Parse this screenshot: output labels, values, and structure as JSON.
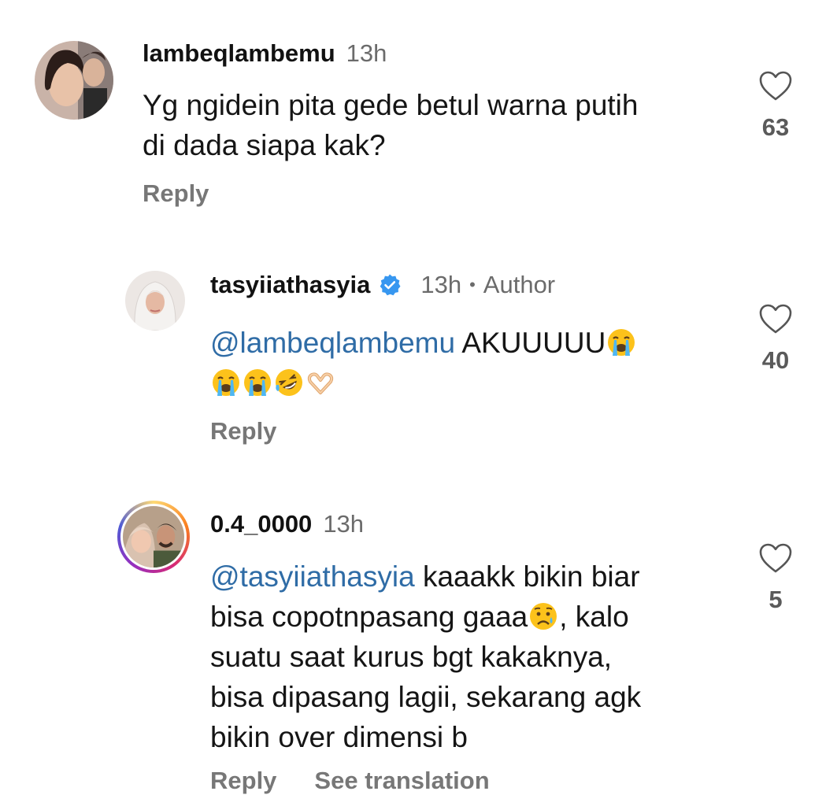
{
  "comments": [
    {
      "username": "lambeqlambemu",
      "time": "13h",
      "text": "Yg ngidein pita gede betul warna putih\ndi dada siapa kak?",
      "likes": "63",
      "reply_label": "Reply",
      "avatar_icon": "profile-photo"
    },
    {
      "username": "tasyiiathasyia",
      "time": "13h",
      "dot": "•",
      "author_label": "Author",
      "mention": "@lambeqlambemu",
      "text_after_mention": " AKUUUUU",
      "emojis": [
        "loudly-crying-face",
        "loudly-crying-face",
        "loudly-crying-face",
        "rolling-on-floor-laughing",
        "heart-hands"
      ],
      "likes": "40",
      "reply_label": "Reply",
      "verified_icon": "verified-badge-icon",
      "verified_color": "#3797f0"
    },
    {
      "username": "0.4_0000",
      "time": "13h",
      "mention": "@tasyiiathasyia",
      "text_part1": " kaaakk bikin biar\nbisa copotnpasang gaaa",
      "emoji": "sad-tear-face",
      "text_part2": ", kalo\nsuatu saat kurus bgt kakaknya,\nbisa dipasang lagii,  sekarang agk\nbikin over dimensi b",
      "likes": "5",
      "reply_label": "Reply",
      "translate_label": "See translation"
    }
  ],
  "colors": {
    "mention": "#2f6ca6",
    "muted": "#6b6b6b",
    "story_ring": "#d62976"
  }
}
